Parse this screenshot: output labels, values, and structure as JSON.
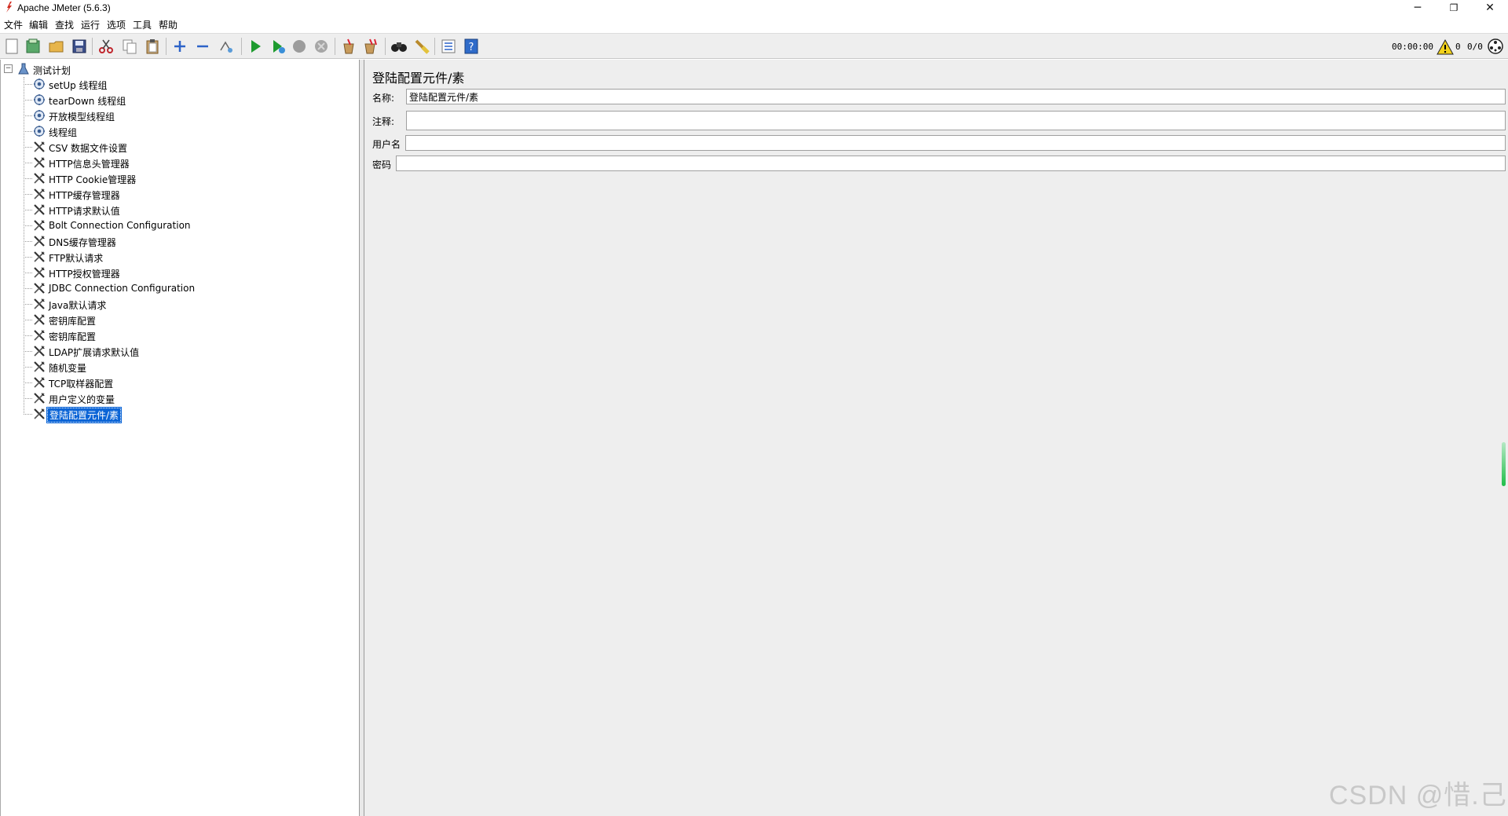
{
  "window": {
    "title": "Apache JMeter (5.6.3)",
    "controls": {
      "minimize": "─",
      "maximize": "❐",
      "close": "✕"
    }
  },
  "menu": [
    "文件",
    "编辑",
    "查找",
    "运行",
    "选项",
    "工具",
    "帮助"
  ],
  "toolbar": {
    "icons": [
      "new-icon",
      "templates-icon",
      "open-icon",
      "save-icon",
      "cut-icon",
      "copy-icon",
      "paste-icon",
      "expand-icon",
      "collapse-icon",
      "toggle-icon",
      "start-icon",
      "start-no-pause-icon",
      "stop-icon",
      "shutdown-icon",
      "clear-icon",
      "clear-all-icon",
      "search-icon",
      "reset-search-icon",
      "function-helper-icon",
      "help-icon"
    ],
    "timer": "00:00:00",
    "warning_count": "0",
    "threads": "0/0"
  },
  "tree": {
    "root": "测试计划",
    "items": [
      {
        "label": "setUp 线程组",
        "icon": "thread-group-icon"
      },
      {
        "label": "tearDown 线程组",
        "icon": "thread-group-icon"
      },
      {
        "label": "开放模型线程组",
        "icon": "thread-group-icon"
      },
      {
        "label": "线程组",
        "icon": "thread-group-icon"
      },
      {
        "label": "CSV 数据文件设置",
        "icon": "config-element-icon"
      },
      {
        "label": "HTTP信息头管理器",
        "icon": "config-element-icon"
      },
      {
        "label": "HTTP Cookie管理器",
        "icon": "config-element-icon"
      },
      {
        "label": "HTTP缓存管理器",
        "icon": "config-element-icon"
      },
      {
        "label": "HTTP请求默认值",
        "icon": "config-element-icon"
      },
      {
        "label": "Bolt Connection Configuration",
        "icon": "config-element-icon"
      },
      {
        "label": "DNS缓存管理器",
        "icon": "config-element-icon"
      },
      {
        "label": "FTP默认请求",
        "icon": "config-element-icon"
      },
      {
        "label": "HTTP授权管理器",
        "icon": "config-element-icon"
      },
      {
        "label": "JDBC Connection Configuration",
        "icon": "config-element-icon"
      },
      {
        "label": "Java默认请求",
        "icon": "config-element-icon"
      },
      {
        "label": "密钥库配置",
        "icon": "config-element-icon"
      },
      {
        "label": "密钥库配置",
        "icon": "config-element-icon"
      },
      {
        "label": "LDAP扩展请求默认值",
        "icon": "config-element-icon"
      },
      {
        "label": "随机变量",
        "icon": "config-element-icon"
      },
      {
        "label": "TCP取样器配置",
        "icon": "config-element-icon"
      },
      {
        "label": "用户定义的变量",
        "icon": "config-element-icon"
      },
      {
        "label": "登陆配置元件/素",
        "icon": "config-element-icon",
        "selected": true
      }
    ]
  },
  "panel": {
    "title": "登陆配置元件/素",
    "name_label": "名称:",
    "name_value": "登陆配置元件/素",
    "comment_label": "注释:",
    "comment_value": "",
    "username_label": "用户名",
    "username_value": "",
    "password_label": "密码",
    "password_value": ""
  },
  "watermark": "CSDN @惜.己"
}
